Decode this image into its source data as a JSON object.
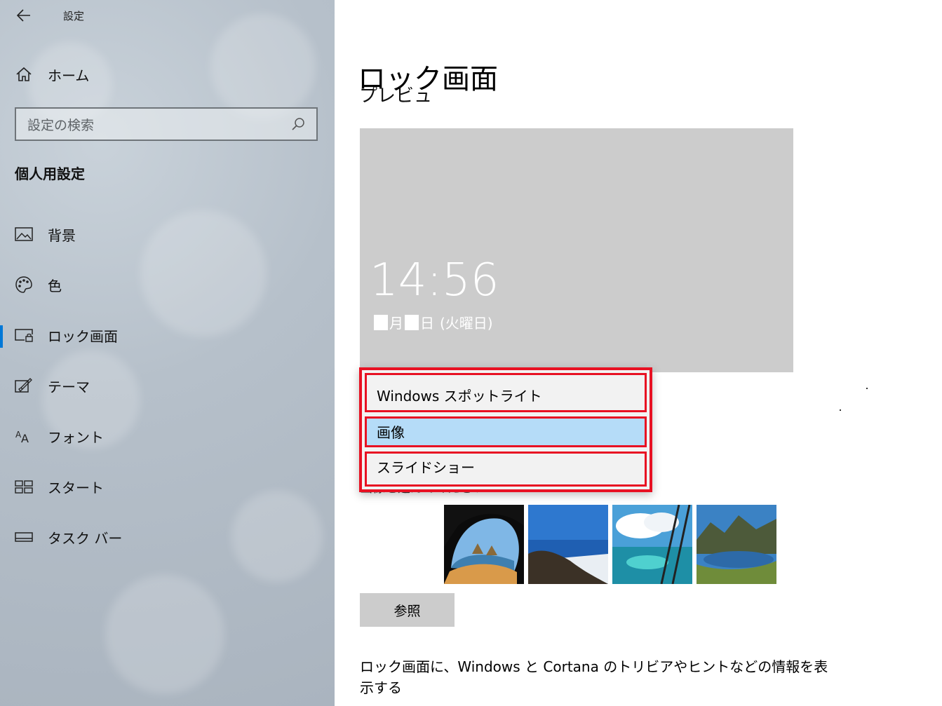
{
  "app": {
    "title": "設定"
  },
  "sidebar": {
    "home_label": "ホーム",
    "search_placeholder": "設定の検索",
    "section_title": "個人用設定",
    "items": [
      {
        "label": "背景",
        "icon": "picture-icon"
      },
      {
        "label": "色",
        "icon": "palette-icon"
      },
      {
        "label": "ロック画面",
        "icon": "lock-screen-icon",
        "active": true
      },
      {
        "label": "テーマ",
        "icon": "theme-brush-icon"
      },
      {
        "label": "フォント",
        "icon": "font-icon"
      },
      {
        "label": "スタート",
        "icon": "start-grid-icon"
      },
      {
        "label": "タスク バー",
        "icon": "taskbar-icon"
      }
    ]
  },
  "main": {
    "page_title": "ロック画面",
    "preview_heading_partial": "プレビュー",
    "preview": {
      "time": "14:56",
      "date_month_suffix": "月",
      "date_day_suffix": "日",
      "date_weekday": "(火曜日)"
    },
    "background_dropdown": {
      "options": [
        "Windows スポットライト",
        "画像",
        "スライドショー"
      ],
      "selected": "画像"
    },
    "choose_image_label": "画像を選んでください",
    "browse_button": "参照",
    "info_text": "ロック画面に、Windows と Cortana のトリビアやヒントなどの情報を表示する"
  },
  "colors": {
    "accent": "#0078d7",
    "highlight": "#e81123",
    "selected_option": "#b5dcf8",
    "preview_bg": "#cccccc"
  }
}
